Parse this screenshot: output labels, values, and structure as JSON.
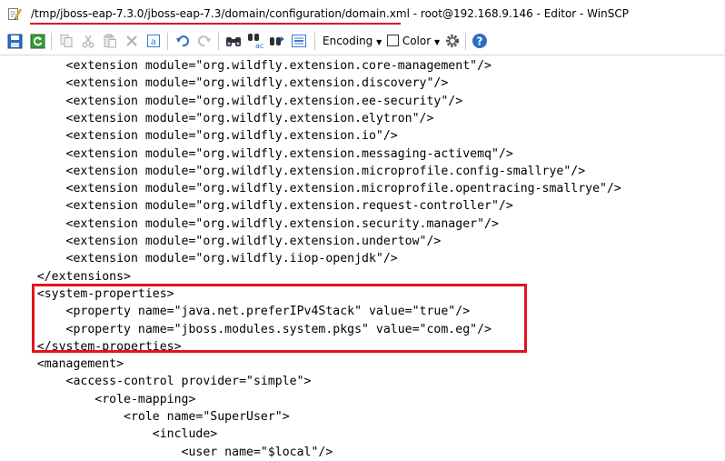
{
  "window": {
    "title_path": "/tmp/jboss-eap-7.3.0/jboss-eap-7.3/domain/configuration/domain.xml",
    "title_rest": " - root@192.168.9.146 - Editor - WinSCP"
  },
  "toolbar": {
    "encoding_label": "Encoding",
    "color_label": "Color",
    "icons": [
      "save-icon",
      "reload-icon",
      "copy-icon",
      "cut-icon",
      "paste-icon",
      "delete-icon",
      "select-all-icon",
      "undo-icon",
      "redo-icon",
      "find-icon",
      "replace-icon",
      "find-next-icon",
      "goto-line-icon",
      "encoding-dropdown",
      "color-checkbox",
      "preferences-icon",
      "help-icon"
    ]
  },
  "editor": {
    "lines": [
      "        <extension module=\"org.wildfly.extension.core-management\"/>",
      "        <extension module=\"org.wildfly.extension.discovery\"/>",
      "        <extension module=\"org.wildfly.extension.ee-security\"/>",
      "        <extension module=\"org.wildfly.extension.elytron\"/>",
      "        <extension module=\"org.wildfly.extension.io\"/>",
      "        <extension module=\"org.wildfly.extension.messaging-activemq\"/>",
      "        <extension module=\"org.wildfly.extension.microprofile.config-smallrye\"/>",
      "        <extension module=\"org.wildfly.extension.microprofile.opentracing-smallrye\"/>",
      "        <extension module=\"org.wildfly.extension.request-controller\"/>",
      "        <extension module=\"org.wildfly.extension.security.manager\"/>",
      "        <extension module=\"org.wildfly.extension.undertow\"/>",
      "        <extension module=\"org.wildfly.iiop-openjdk\"/>",
      "    </extensions>",
      "    <system-properties>",
      "        <property name=\"java.net.preferIPv4Stack\" value=\"true\"/>",
      "        <property name=\"jboss.modules.system.pkgs\" value=\"com.eg\"/>",
      "    </system-properties>",
      "    <management>",
      "        <access-control provider=\"simple\">",
      "            <role-mapping>",
      "                <role name=\"SuperUser\">",
      "                    <include>",
      "                        <user name=\"$local\"/>"
    ]
  }
}
